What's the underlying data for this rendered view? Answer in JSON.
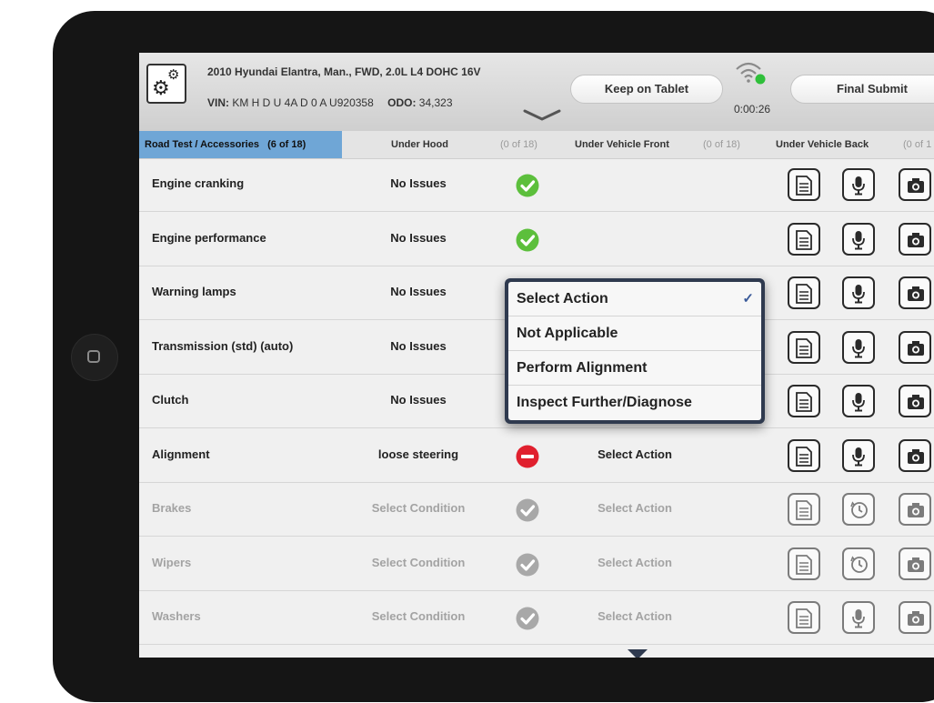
{
  "header": {
    "vehicle": "2010 Hyundai Elantra, Man., FWD, 2.0L L4 DOHC 16V",
    "vin_label": "VIN:",
    "vin_value": "KM H D U 4A D 0 A U920358",
    "odo_label": "ODO:",
    "odo_value": "34,323",
    "keep_label": "Keep on Tablet",
    "submit_label": "Final Submit",
    "timer": "0:00:26"
  },
  "tabs": [
    {
      "label": "Road Test / Accessories",
      "count": "(6 of 18)",
      "active": true
    },
    {
      "label": "Under Hood",
      "count": "(0 of 18)"
    },
    {
      "label": "Under Vehicle Front",
      "count": "(0 of 18)"
    },
    {
      "label": "Under Vehicle Back",
      "count": "(0 of 1"
    }
  ],
  "rows": [
    {
      "item": "Engine cranking",
      "condition": "No Issues",
      "status": "ok",
      "action": "",
      "dim": false,
      "second_icon": "microphone-icon"
    },
    {
      "item": "Engine performance",
      "condition": "No Issues",
      "status": "ok",
      "action": "",
      "dim": false,
      "second_icon": "microphone-icon"
    },
    {
      "item": "Warning lamps",
      "condition": "No Issues",
      "status": "ok",
      "action": "",
      "dim": false,
      "second_icon": "microphone-icon"
    },
    {
      "item": "Transmission (std) (auto)",
      "condition": "No Issues",
      "status": "ok",
      "action": "",
      "dim": false,
      "second_icon": "microphone-icon"
    },
    {
      "item": "Clutch",
      "condition": "No Issues",
      "status": "ok",
      "action": "",
      "dim": false,
      "second_icon": "microphone-icon"
    },
    {
      "item": "Alignment",
      "condition": "loose steering",
      "status": "issue",
      "action": "Select Action",
      "dim": false,
      "second_icon": "microphone-icon"
    },
    {
      "item": "Brakes",
      "condition": "Select Condition",
      "status": "pending",
      "action": "Select Action",
      "dim": true,
      "second_icon": "history-icon"
    },
    {
      "item": "Wipers",
      "condition": "Select Condition",
      "status": "pending",
      "action": "Select Action",
      "dim": true,
      "second_icon": "history-icon"
    },
    {
      "item": "Washers",
      "condition": "Select Condition",
      "status": "pending",
      "action": "Select Action",
      "dim": true,
      "second_icon": "microphone-icon"
    }
  ],
  "dropdown": {
    "options": [
      "Select Action",
      "Not Applicable",
      "Perform Alignment",
      "Inspect Further/Diagnose"
    ],
    "selected": "Select Action",
    "check": "✓"
  },
  "colors": {
    "active_tab": "#6fa6d6",
    "ok_green": "#5cbf3c",
    "issue_red": "#e0202e",
    "pending_gray": "#a8a8a8",
    "wifi_status": "#2fbf3a",
    "dropdown_frame": "#2f3a4f"
  }
}
